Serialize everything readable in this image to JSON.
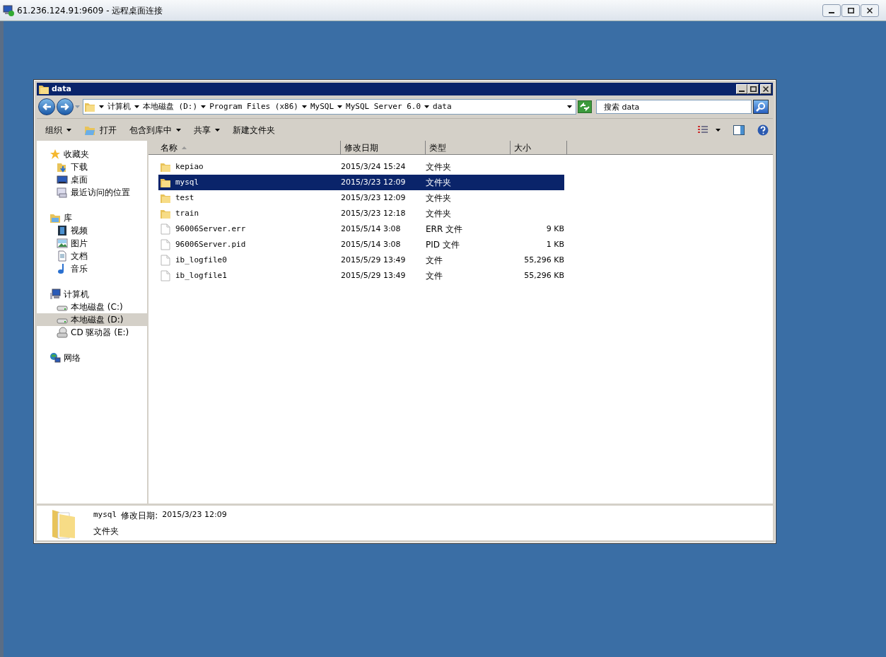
{
  "remote_window": {
    "title": "61.236.124.91:9609 - 远程桌面连接"
  },
  "explorer": {
    "title": "data",
    "breadcrumb": [
      "计算机",
      "本地磁盘 (D:)",
      "Program Files (x86)",
      "MySQL",
      "MySQL Server 6.0",
      "data"
    ],
    "search": {
      "placeholder": "搜索 data"
    },
    "toolbar": [
      {
        "label": "组织",
        "kind": "menu"
      },
      {
        "label": "打开",
        "kind": "open"
      },
      {
        "label": "包含到库中",
        "kind": "menu"
      },
      {
        "label": "共享",
        "kind": "menu"
      },
      {
        "label": "新建文件夹",
        "kind": "plain"
      }
    ],
    "nav": [
      {
        "label": "收藏夹",
        "kind": "star",
        "selected": false,
        "children": [
          {
            "label": "下载",
            "kind": "download",
            "selected": false
          },
          {
            "label": "桌面",
            "kind": "desktop",
            "selected": false
          },
          {
            "label": "最近访问的位置",
            "kind": "recent",
            "selected": false
          }
        ]
      },
      {
        "label": "库",
        "kind": "library",
        "selected": false,
        "children": [
          {
            "label": "视频",
            "kind": "video",
            "selected": false
          },
          {
            "label": "图片",
            "kind": "image",
            "selected": false
          },
          {
            "label": "文档",
            "kind": "document",
            "selected": false
          },
          {
            "label": "音乐",
            "kind": "music",
            "selected": false
          }
        ]
      },
      {
        "label": "计算机",
        "kind": "computer",
        "selected": false,
        "children": [
          {
            "label": "本地磁盘 (C:)",
            "kind": "drive",
            "selected": false
          },
          {
            "label": "本地磁盘 (D:)",
            "kind": "drive",
            "selected": true
          },
          {
            "label": "CD 驱动器 (E:)",
            "kind": "cd",
            "selected": false
          }
        ]
      },
      {
        "label": "网络",
        "kind": "network",
        "selected": false
      }
    ],
    "columns": [
      "名称",
      "修改日期",
      "类型",
      "大小"
    ],
    "files": [
      {
        "name": "kepiao",
        "kind": "folder",
        "date": "2015/3/24 15:24",
        "type": "文件夹",
        "selected": false
      },
      {
        "name": "mysql",
        "kind": "folder",
        "date": "2015/3/23 12:09",
        "type": "文件夹",
        "selected": true
      },
      {
        "name": "test",
        "kind": "folder",
        "date": "2015/3/23 12:09",
        "type": "文件夹",
        "selected": false
      },
      {
        "name": "train",
        "kind": "folder",
        "date": "2015/3/23 12:18",
        "type": "文件夹",
        "selected": false
      },
      {
        "name": "96006Server.err",
        "kind": "file",
        "date": "2015/5/14 3:08",
        "type": "ERR 文件",
        "size": "9 KB",
        "selected": false
      },
      {
        "name": "96006Server.pid",
        "kind": "file",
        "date": "2015/5/14 3:08",
        "type": "PID 文件",
        "size": "1 KB",
        "selected": false
      },
      {
        "name": "ib_logfile0",
        "kind": "file",
        "date": "2015/5/29 13:49",
        "type": "文件",
        "size": "55,296 KB",
        "selected": false
      },
      {
        "name": "ib_logfile1",
        "kind": "file",
        "date": "2015/5/29 13:49",
        "type": "文件",
        "size": "55,296 KB",
        "selected": false
      }
    ],
    "details": {
      "name": "mysql",
      "date_label": "修改日期:",
      "date": "2015/3/23 12:09",
      "type": "文件夹"
    }
  }
}
